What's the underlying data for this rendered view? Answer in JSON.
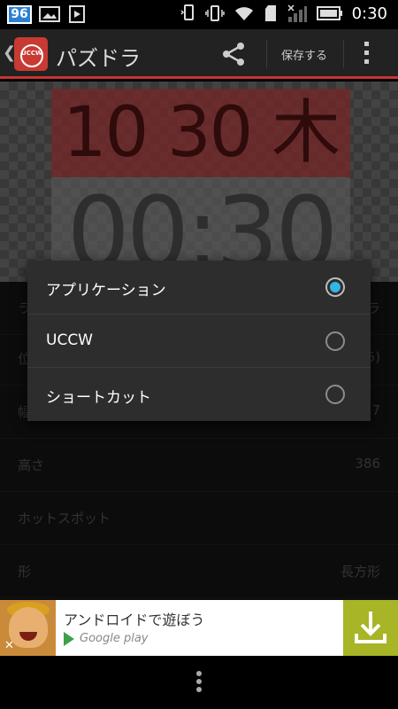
{
  "status_bar": {
    "notification_badge": "96",
    "time": "0:30",
    "icons": [
      "image-icon",
      "play-store-icon",
      "phone-vibrate-icon",
      "vibrate-icon",
      "wifi-icon",
      "sd-card-icon",
      "signal-icon",
      "battery-icon"
    ]
  },
  "action_bar": {
    "app_icon_text": "UCCW",
    "title": "パズドラ",
    "save_label": "保存する",
    "icons": [
      "back-icon",
      "share-icon",
      "overflow-icon"
    ],
    "accent_color": "#c73434"
  },
  "preview": {
    "date_text": "10 30 木",
    "time_text": "00:30"
  },
  "settings": {
    "rows": [
      {
        "label": "ラ",
        "value": "ラ"
      },
      {
        "label": "位",
        "value": "5)"
      },
      {
        "label": "幅",
        "value": "7"
      },
      {
        "label": "高さ",
        "value": "386"
      },
      {
        "label": "ホットスポット",
        "value": ""
      },
      {
        "label": "形",
        "value": "長方形"
      }
    ]
  },
  "dialog": {
    "options": [
      {
        "label": "アプリケーション",
        "selected": true
      },
      {
        "label": "UCCW",
        "selected": false
      },
      {
        "label": "ショートカット",
        "selected": false
      }
    ],
    "radio_color": "#33b5e5"
  },
  "ad": {
    "title": "アンドロイドで遊ぼう",
    "store": "Google play",
    "close": "✕",
    "download_color": "#a7b526"
  }
}
